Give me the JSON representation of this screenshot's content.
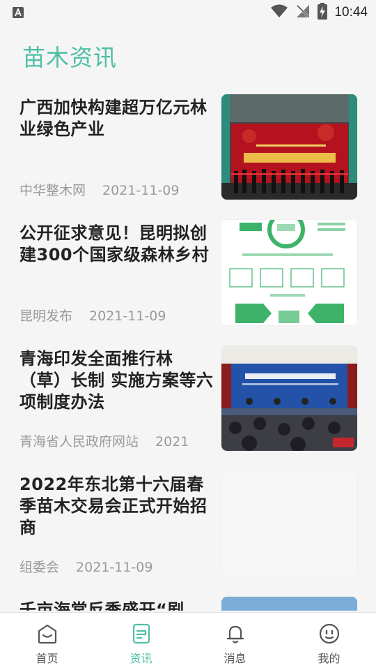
{
  "status_bar": {
    "left_icon": "a-notification-icon",
    "icons": [
      "wifi-icon",
      "signal-off-icon",
      "battery-charging-icon"
    ],
    "time": "10:44"
  },
  "header": {
    "title": "苗木资讯"
  },
  "news": [
    {
      "title": "广西加快构建超万亿元林业绿色产业",
      "source": "中华整木网",
      "date": "2021-11-09",
      "thumb": "expo-ribbon-cutting-photo"
    },
    {
      "title": "公开征求意见！昆明拟创建300个国家级森林乡村",
      "source": "昆明发布",
      "date": "2021-11-09",
      "thumb": "forest-infographic"
    },
    {
      "title": "青海印发全面推行林（草）长制 实施方案等六项制度办法",
      "source": "青海省人民政府网站",
      "date": "2021",
      "thumb": "press-conference-photo"
    },
    {
      "title": "2022年东北第十六届春季苗木交易会正式开始招商",
      "source": "组委会",
      "date": "2021-11-09",
      "thumb": "blank-placeholder"
    },
    {
      "title": "千亩海棠反季盛开“剧",
      "source": "",
      "date": "",
      "thumb": "sky-photo"
    }
  ],
  "bottom_nav": {
    "items": [
      {
        "label": "首页",
        "icon": "home-icon",
        "active": false
      },
      {
        "label": "资讯",
        "icon": "news-icon",
        "active": true
      },
      {
        "label": "消息",
        "icon": "bell-icon",
        "active": false
      },
      {
        "label": "我的",
        "icon": "smiley-profile-icon",
        "active": false
      }
    ]
  },
  "colors": {
    "accent": "#4fbfa6",
    "background": "#f5f5f5",
    "meta_text": "#9a9a9a"
  }
}
